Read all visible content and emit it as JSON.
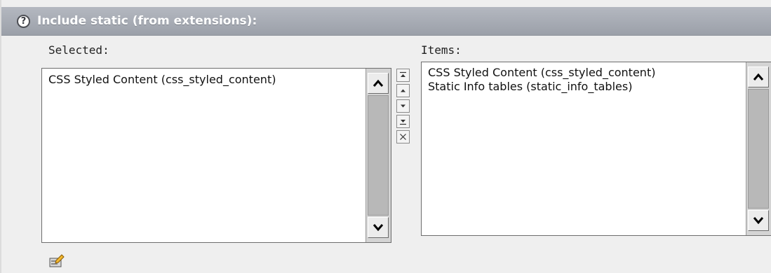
{
  "header": {
    "help_icon_glyph": "?",
    "title": "Include static (from extensions):"
  },
  "selected": {
    "label": "Selected:",
    "items": [
      "CSS Styled Content (css_styled_content)"
    ]
  },
  "items": {
    "label": "Items:",
    "items": [
      "CSS Styled Content (css_styled_content)",
      "Static Info tables (static_info_tables)"
    ]
  },
  "move_buttons": [
    "move-top-icon",
    "move-up-icon",
    "move-down-icon",
    "move-bottom-icon",
    "remove-icon"
  ],
  "footer": {
    "icon": "edit-record-icon"
  },
  "colors": {
    "header_bg": "#a8acb4",
    "panel_bg": "#efefef",
    "scrollbar": "#d4d4d4"
  }
}
